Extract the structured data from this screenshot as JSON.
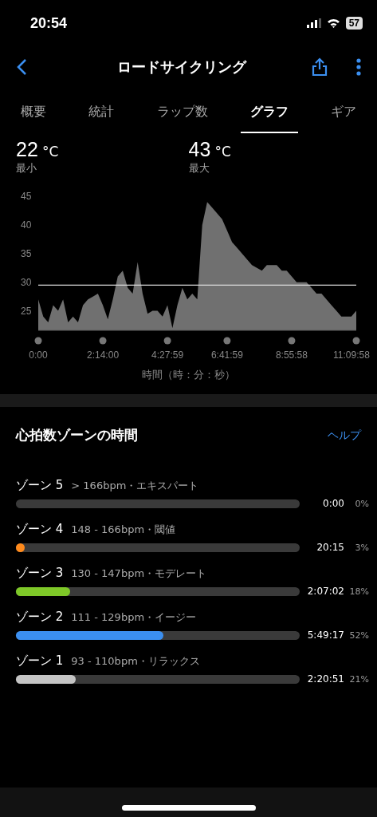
{
  "status_bar": {
    "time": "20:54",
    "battery": "57"
  },
  "nav": {
    "title": "ロードサイクリング"
  },
  "tabs": [
    {
      "label": "概要",
      "selected": false
    },
    {
      "label": "統計",
      "selected": false
    },
    {
      "label": "ラップ数",
      "selected": false
    },
    {
      "label": "グラフ",
      "selected": true
    },
    {
      "label": "ギア",
      "selected": false
    }
  ],
  "temperature": [
    {
      "value": "22",
      "unit": "°C",
      "label": "最小"
    },
    {
      "value": "43",
      "unit": "°C",
      "label": "最大"
    }
  ],
  "chart": {
    "chart_data": {
      "type": "area",
      "xlabel": "時間（時：分：秒）",
      "categories": [
        "0:00",
        null,
        null,
        null,
        null,
        null,
        null,
        null,
        null,
        null,
        null,
        null,
        null,
        "2:14:00",
        null,
        null,
        null,
        null,
        null,
        null,
        null,
        null,
        null,
        null,
        null,
        null,
        "4:27:59",
        null,
        null,
        null,
        null,
        null,
        null,
        null,
        null,
        null,
        null,
        null,
        "6:41:59",
        null,
        null,
        null,
        null,
        null,
        null,
        null,
        null,
        null,
        null,
        null,
        null,
        "8:55:58",
        null,
        null,
        null,
        null,
        null,
        null,
        null,
        null,
        null,
        null,
        null,
        null,
        "11:09:58"
      ],
      "series": [
        {
          "color": "#707070",
          "values": [
            27,
            24,
            23,
            26,
            25,
            27,
            23,
            24,
            23,
            26,
            27,
            27.5,
            28,
            26,
            23.5,
            27,
            31,
            32,
            29,
            28,
            33.5,
            28,
            24.5,
            25,
            25,
            24,
            26,
            22,
            26,
            29,
            27,
            28,
            27,
            40,
            44,
            43,
            42,
            41,
            39,
            37,
            36,
            35,
            34,
            33,
            32.5,
            32,
            33,
            33,
            33,
            32,
            32,
            31,
            30,
            30,
            30,
            29,
            28,
            28,
            27,
            26,
            25,
            24,
            24,
            24,
            25
          ]
        }
      ],
      "ylim": [
        21.6,
        45
      ],
      "yticks": [
        25,
        30,
        35,
        40,
        45
      ],
      "ref_lines": [
        {
          "axis": "y",
          "value": 29.5
        }
      ]
    }
  },
  "zones": {
    "title": "心拍数ゾーンの時間",
    "help": "ヘルプ",
    "items": [
      {
        "name": "ゾーン 5",
        "range": "> 166bpm・エキスパート",
        "time": "0:00",
        "percent": "0%"
      },
      {
        "name": "ゾーン 4",
        "range": "148 - 166bpm・閾値",
        "time": "20:15",
        "percent": "3%",
        "level": 0.03,
        "color": "#ff8a1c"
      },
      {
        "name": "ゾーン 3",
        "range": "130 - 147bpm・モデレート",
        "time": "2:07:02",
        "percent": "18%",
        "level": 0.19,
        "color": "#7ec828"
      },
      {
        "name": "ゾーン 2",
        "range": "111 - 129bpm・イージー",
        "time": "5:49:17",
        "percent": "52%",
        "level": 0.52,
        "color": "#3b8ff0"
      },
      {
        "name": "ゾーン 1",
        "range": "93 - 110bpm・リラックス",
        "time": "2:20:51",
        "percent": "21%",
        "level": 0.21,
        "color": "#c4c4c4"
      }
    ]
  }
}
